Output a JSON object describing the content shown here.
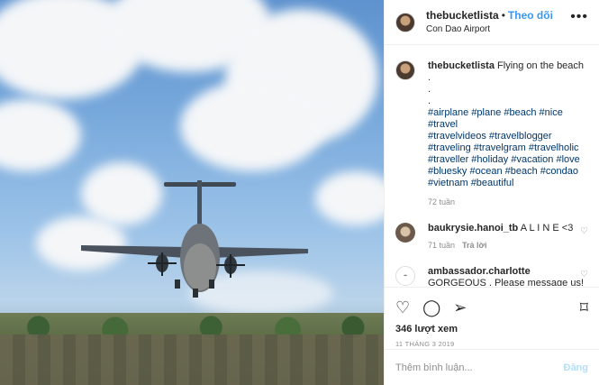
{
  "header": {
    "username": "thebucketlista",
    "separator": "•",
    "follow_label": "Theo dõi",
    "location": "Con Dao Airport",
    "more_icon": "ellipsis-icon"
  },
  "caption": {
    "username": "thebucketlista",
    "text": "Flying on the beach .",
    "dots": [
      ".",
      "."
    ],
    "hashtags": [
      "#airplane #plane #beach #nice #travel",
      "#travelvideos #travelblogger",
      "#traveling #travelgram #travelholic",
      "#traveller #holiday #vacation #love",
      "#bluesky #ocean #beach #condao",
      "#vietnam #beautiful"
    ],
    "time": "72 tuần"
  },
  "comments": [
    {
      "username": "baukrysie.hanoi_tb",
      "text": "A L I N E <3",
      "time": "71 tuần",
      "reply": "Trả lời"
    },
    {
      "username": "ambassador.charlotte",
      "text": "GORGEOUS , Please message us!",
      "emoji": "💞",
      "time": "",
      "reply": ""
    }
  ],
  "actions": {
    "like_icon": "heart-icon",
    "comment_icon": "comment-icon",
    "share_icon": "paper-plane-icon",
    "save_icon": "bookmark-icon",
    "views": "346 lượt xem",
    "date": "11 THÁNG 3 2019"
  },
  "add_comment": {
    "placeholder": "Thêm bình luận...",
    "post_label": "Đăng"
  },
  "colors": {
    "accent": "#3897f0",
    "hashtag": "#00376b",
    "muted": "#8e8e8e",
    "post_disabled": "#b2dffc"
  }
}
